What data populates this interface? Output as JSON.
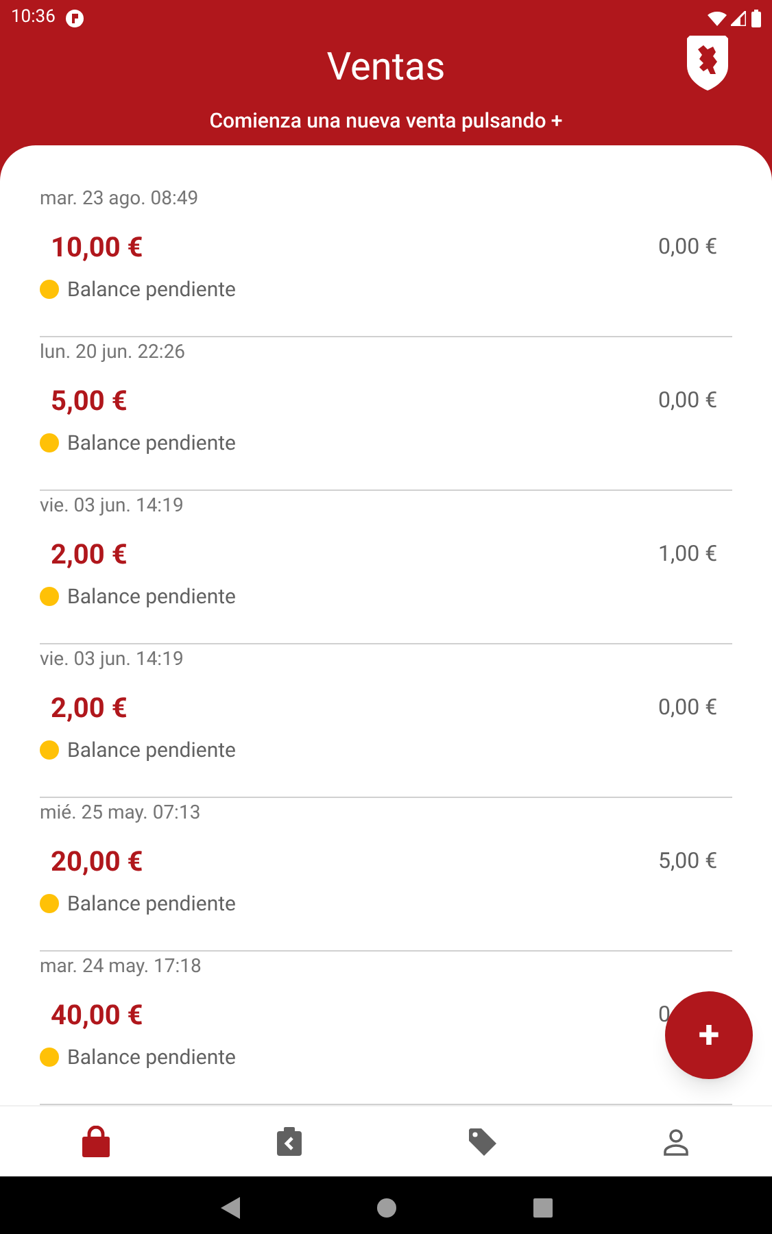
{
  "status_bar": {
    "time": "10:36"
  },
  "header": {
    "title": "Ventas",
    "subtitle": "Comienza una nueva venta pulsando +"
  },
  "sales": [
    {
      "date": "mar. 23 ago. 08:49",
      "total": "10,00 €",
      "paid": "0,00 €",
      "status": "Balance pendiente",
      "color": "#ffc107"
    },
    {
      "date": "lun. 20 jun. 22:26",
      "total": "5,00 €",
      "paid": "0,00 €",
      "status": "Balance pendiente",
      "color": "#ffc107"
    },
    {
      "date": "vie. 03 jun. 14:19",
      "total": "2,00 €",
      "paid": "1,00 €",
      "status": "Balance pendiente",
      "color": "#ffc107"
    },
    {
      "date": "vie. 03 jun. 14:19",
      "total": "2,00 €",
      "paid": "0,00 €",
      "status": "Balance pendiente",
      "color": "#ffc107"
    },
    {
      "date": "mié. 25 may. 07:13",
      "total": "20,00 €",
      "paid": "5,00 €",
      "status": "Balance pendiente",
      "color": "#ffc107"
    },
    {
      "date": "mar. 24 may. 17:18",
      "total": "40,00 €",
      "paid": "0",
      "status": "Balance pendiente",
      "color": "#ffc107"
    }
  ],
  "fab": {
    "label": "+"
  },
  "bottom_nav": [
    {
      "kind": "bag",
      "selected": true
    },
    {
      "kind": "clipboard",
      "selected": false
    },
    {
      "kind": "tag",
      "selected": false
    },
    {
      "kind": "person",
      "selected": false
    }
  ]
}
